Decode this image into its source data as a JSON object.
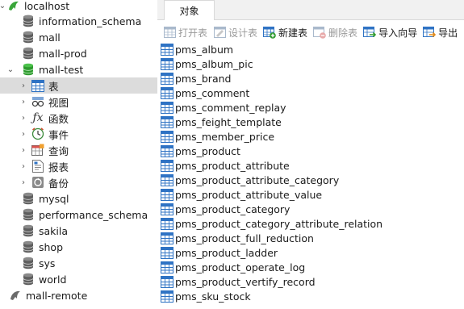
{
  "sidebar": {
    "connection": "localhost",
    "databases": {
      "information_schema": "information_schema",
      "mall": "mall",
      "mall_prod": "mall-prod",
      "mall_test": "mall-test",
      "mysql": "mysql",
      "performance_schema": "performance_schema",
      "sakila": "sakila",
      "shop": "shop",
      "sys": "sys",
      "world": "world"
    },
    "mall_test_children": {
      "tables": "表",
      "views": "视图",
      "functions": "函数",
      "events": "事件",
      "queries": "查询",
      "reports": "报表",
      "backups": "备份"
    },
    "remote_connection": "mall-remote"
  },
  "tabs": {
    "objects": "对象"
  },
  "toolbar": {
    "open_table": "打开表",
    "design_table": "设计表",
    "new_table": "新建表",
    "delete_table": "删除表",
    "import_wizard": "导入向导",
    "export_wizard": "导出"
  },
  "tables": [
    "pms_album",
    "pms_album_pic",
    "pms_brand",
    "pms_comment",
    "pms_comment_replay",
    "pms_feight_template",
    "pms_member_price",
    "pms_product",
    "pms_product_attribute",
    "pms_product_attribute_category",
    "pms_product_attribute_value",
    "pms_product_category",
    "pms_product_category_attribute_relation",
    "pms_product_full_reduction",
    "pms_product_ladder",
    "pms_product_operate_log",
    "pms_product_vertify_record",
    "pms_sku_stock"
  ],
  "colors": {
    "connection_green": "#3aa63a",
    "database_gray": "#6a6a6a",
    "table_blue": "#2f73c4",
    "selection": "#dcdcdc"
  }
}
